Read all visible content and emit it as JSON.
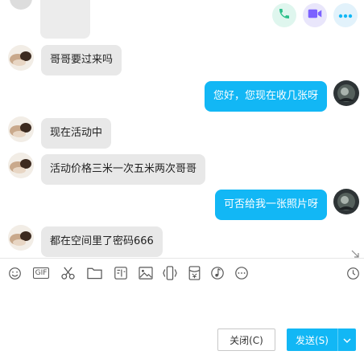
{
  "header": {
    "call_icon": "phone-icon",
    "video_icon": "video-camera-icon",
    "more_icon": "more-dots-icon",
    "call_color": "#2cc08a",
    "video_color": "#7b61ff",
    "more_color": "#12b7f5"
  },
  "messages": [
    {
      "direction": "in",
      "text": "哥哥要过来吗"
    },
    {
      "direction": "out",
      "text": "您好，您现在收几张呀"
    },
    {
      "direction": "in",
      "text": "现在活动中"
    },
    {
      "direction": "in",
      "text": "活动价格三米一次五米两次哥哥"
    },
    {
      "direction": "out",
      "text": "可否给我一张照片呀"
    },
    {
      "direction": "in",
      "text": "都在空间里了密码666"
    }
  ],
  "toolbar": {
    "items": [
      "emoji-icon",
      "gif-icon",
      "scissors-icon",
      "folder-icon",
      "sticker-icon",
      "image-icon",
      "shake-icon",
      "red-packet-icon",
      "music-icon",
      "more-icon",
      "history-clock-icon"
    ],
    "gif_label": "GIF"
  },
  "input": {
    "value": ""
  },
  "buttons": {
    "close_label": "关闭(C)",
    "send_label": "发送(S)"
  },
  "colors": {
    "accent": "#12b7f5",
    "incoming_bubble": "#e8e8e8"
  }
}
